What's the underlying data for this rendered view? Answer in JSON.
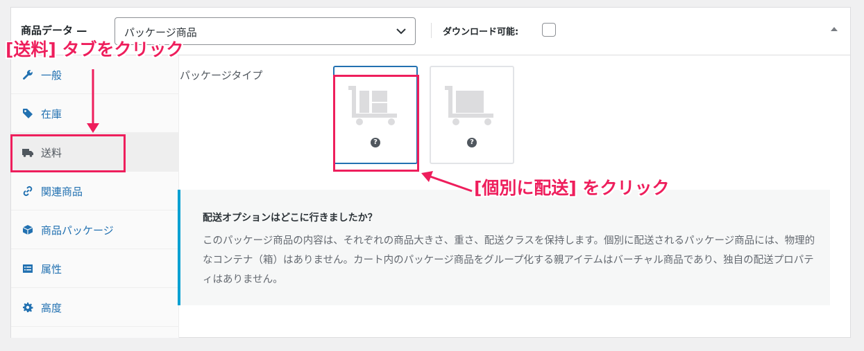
{
  "header": {
    "title": "商品データ —",
    "product_type": "パッケージ商品",
    "downloadable_label": "ダウンロード可能:"
  },
  "sidebar": {
    "items": [
      {
        "label": "一般",
        "icon": "wrench-icon"
      },
      {
        "label": "在庫",
        "icon": "tag-icon"
      },
      {
        "label": "送料",
        "icon": "truck-icon"
      },
      {
        "label": "関連商品",
        "icon": "link-icon"
      },
      {
        "label": "商品パッケージ",
        "icon": "box-icon"
      },
      {
        "label": "属性",
        "icon": "list-icon"
      },
      {
        "label": "高度",
        "icon": "gear-icon"
      }
    ],
    "active_index": 2
  },
  "main": {
    "package_type_label": "パッケージタイプ",
    "options": [
      {
        "icon": "cart-separate-icon",
        "help": "?",
        "selected": true
      },
      {
        "icon": "cart-together-icon",
        "help": "?",
        "selected": false
      }
    ],
    "notice": {
      "title": "配送オプションはどこに行きましたか？",
      "body": "このパッケージ商品の内容は、それぞれの商品大きさ、重さ、配送クラスを保持します。個別に配送されるパッケージ商品には、物理的なコンテナ（箱）はありません。カート内のパッケージ商品をグループ化する親アイテムはバーチャル商品であり、独自の配送プロパティはありません。"
    }
  },
  "annotations": {
    "shipping_tab_note": "[送料] タブをクリック",
    "ship_separately_note": "[個別に配送] をクリック",
    "color": "#ee1e5c"
  },
  "colors": {
    "link": "#2271b1",
    "notice_accent": "#00a0d2",
    "annotation": "#ee1e5c"
  }
}
